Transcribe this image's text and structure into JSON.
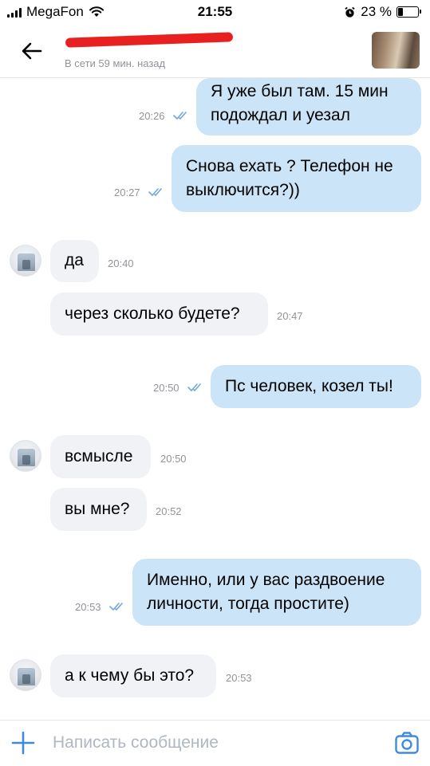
{
  "status_bar": {
    "carrier": "MegaFon",
    "time": "21:55",
    "battery_percent": "23 %",
    "battery_level": 0.23
  },
  "header": {
    "contact_name": "",
    "last_seen": "В сети 59 мин. назад"
  },
  "messages": [
    {
      "direction": "out",
      "lines": [
        "Я уже был там. 15 мин",
        "подождал и уезал"
      ],
      "time": "20:26",
      "read": true
    },
    {
      "direction": "out",
      "lines": [
        "Снова ехать ? Телефон не",
        "выключится?))"
      ],
      "time": "20:27",
      "read": true
    },
    {
      "direction": "in",
      "lines": [
        "да"
      ],
      "time": "20:40"
    },
    {
      "direction": "in",
      "lines": [
        "через сколько будете?"
      ],
      "time": "20:47"
    },
    {
      "direction": "out",
      "lines": [
        "Пс человек, козел ты!"
      ],
      "time": "20:50",
      "read": true
    },
    {
      "direction": "in",
      "lines": [
        "всмысле"
      ],
      "time": "20:50"
    },
    {
      "direction": "in",
      "lines": [
        "вы мне?"
      ],
      "time": "20:52"
    },
    {
      "direction": "out",
      "lines": [
        "Именно, или у вас раздвоение",
        "личности, тогда простите)"
      ],
      "time": "20:53",
      "read": true
    },
    {
      "direction": "in",
      "lines": [
        "а к чему бы это?"
      ],
      "time": "20:53"
    }
  ],
  "composer": {
    "placeholder": "Написать сообщение",
    "value": ""
  },
  "icons": {
    "back": "arrow-left-icon",
    "attach": "plus-icon",
    "camera": "camera-icon",
    "read_receipt": "double-check-icon",
    "wifi": "wifi-icon",
    "alarm": "alarm-clock-icon"
  },
  "colors": {
    "outgoing_bubble": "#cce4f7",
    "incoming_bubble": "#f0f2f5",
    "accent": "#3f8ae0",
    "redaction": "#e8201f",
    "meta_text": "#909499"
  }
}
